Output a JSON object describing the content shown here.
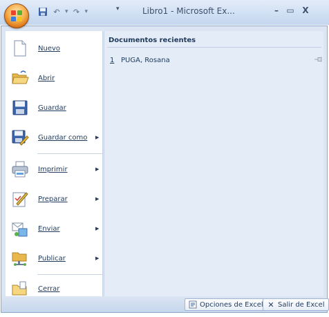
{
  "window": {
    "title": "Libro1 - Microsoft Ex...",
    "minimize_glyph": "–",
    "maximize_glyph": "▭",
    "close_glyph": "X"
  },
  "quick_access": {
    "undo_glyph": "↶",
    "redo_glyph": "↷",
    "dropdown_glyph": "▾",
    "customize_glyph": "▾"
  },
  "menu": {
    "items": [
      {
        "label": "Nuevo",
        "icon": "new-document-icon",
        "submenu": false
      },
      {
        "label": "Abrir",
        "icon": "open-folder-icon",
        "submenu": false
      },
      {
        "label": "Guardar",
        "icon": "save-icon",
        "submenu": false
      },
      {
        "label": "Guardar como",
        "icon": "save-as-icon",
        "submenu": true
      },
      {
        "label": "Imprimir",
        "icon": "printer-icon",
        "submenu": true
      },
      {
        "label": "Preparar",
        "icon": "prepare-icon",
        "submenu": true
      },
      {
        "label": "Enviar",
        "icon": "send-icon",
        "submenu": true
      },
      {
        "label": "Publicar",
        "icon": "publish-icon",
        "submenu": true
      },
      {
        "label": "Cerrar",
        "icon": "close-folder-icon",
        "submenu": false
      }
    ],
    "submenu_glyph": "▶"
  },
  "recent": {
    "header": "Documentos recientes",
    "items": [
      {
        "number": "1",
        "name": "PUGA, Rosana"
      }
    ]
  },
  "footer": {
    "options_label": "Opciones de Excel",
    "exit_label": "Salir de Excel",
    "exit_glyph": "✕"
  },
  "colors": {
    "accent_orange": "#f6b04d",
    "menu_background": "#dbe5f3",
    "text": "#1e395b"
  }
}
